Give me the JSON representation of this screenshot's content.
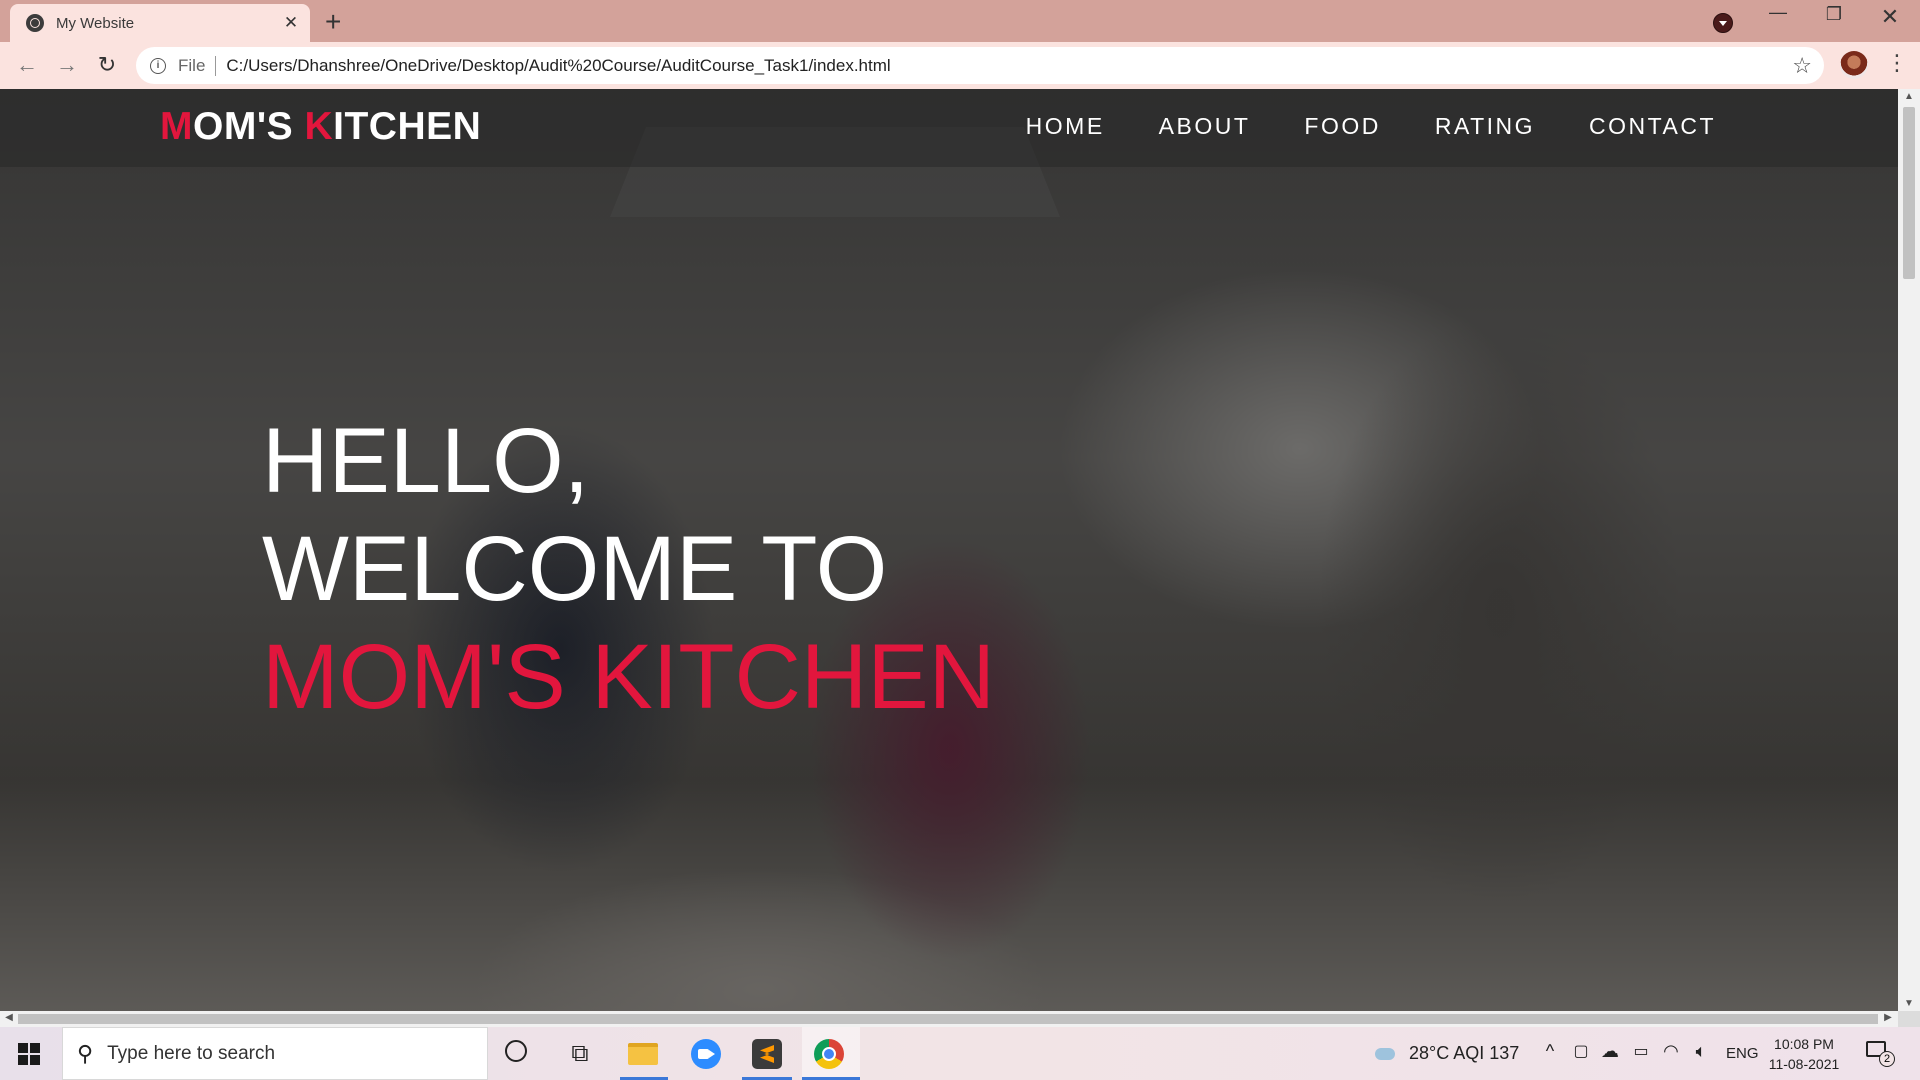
{
  "browser": {
    "tab_title": "My Website",
    "tab_close": "✕",
    "new_tab": "+",
    "file_label": "File",
    "url": "C:/Users/Dhanshree/OneDrive/Desktop/Audit%20Course/AuditCourse_Task1/index.html",
    "win_minimize": "—",
    "win_restore": "❐",
    "win_close": "✕"
  },
  "site": {
    "logo": {
      "first_accent": "M",
      "first_rest": "OM'S ",
      "second_accent": "K",
      "second_rest": "ITCHEN"
    },
    "nav": [
      "HOME",
      "ABOUT",
      "FOOD",
      "RATING",
      "CONTACT"
    ],
    "hero": {
      "line1": "HELLO,",
      "line2": "WELCOME TO",
      "line3": "MOM'S KITCHEN"
    },
    "accent_color": "#e2163d"
  },
  "taskbar": {
    "search_placeholder": "Type here to search",
    "weather": "28°C  AQI 137",
    "language": "ENG",
    "time": "10:08 PM",
    "date": "11-08-2021",
    "notification_count": "2"
  }
}
